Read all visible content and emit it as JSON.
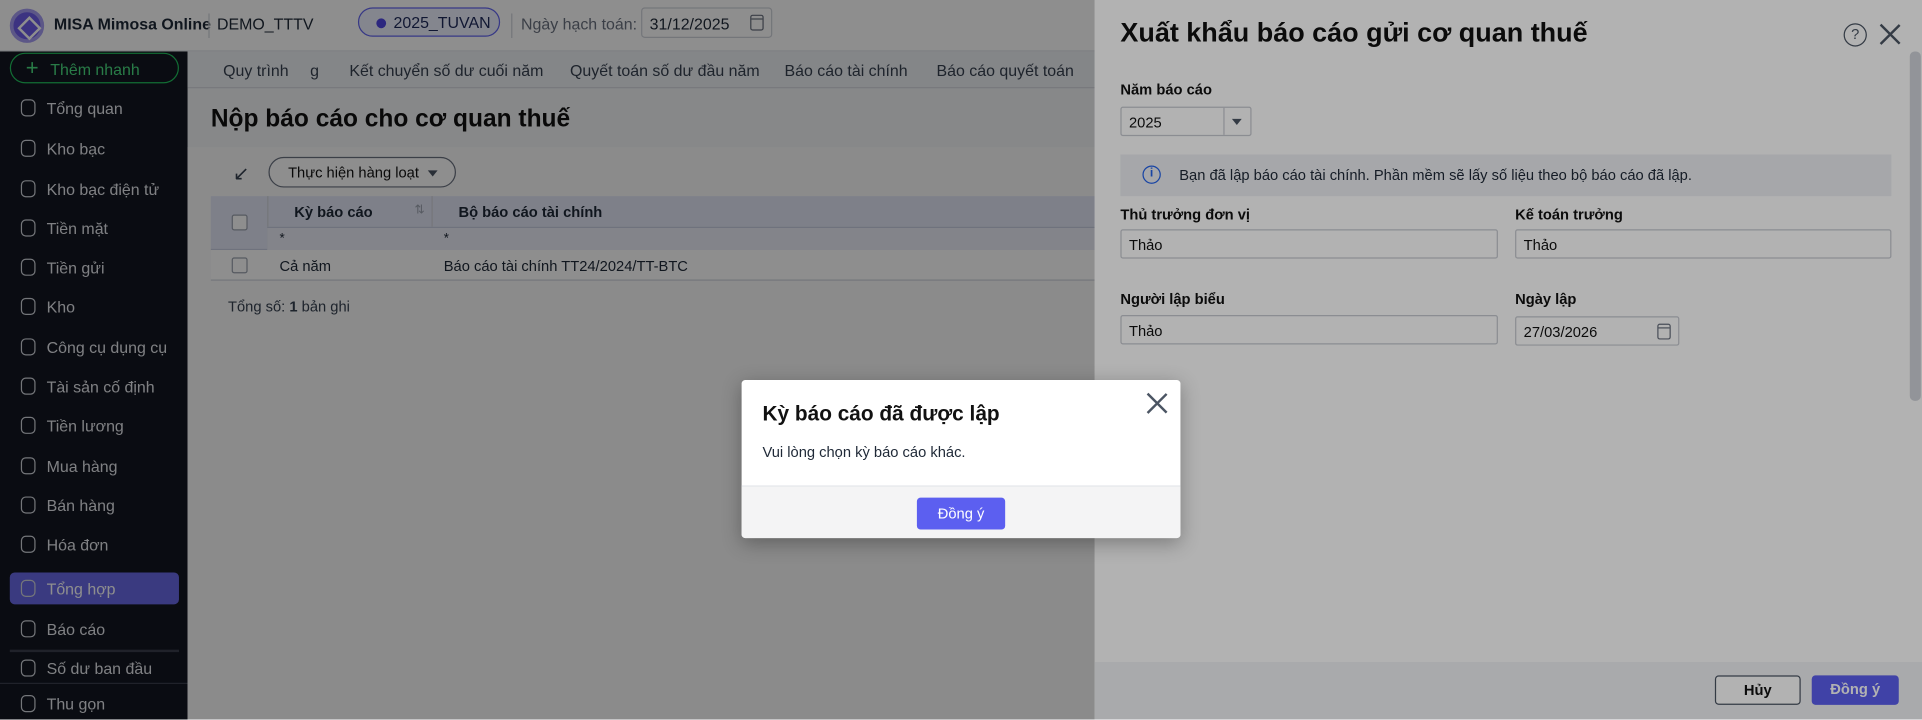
{
  "topbar": {
    "app_name": "MISA Mimosa Online",
    "company": "DEMO_TTTV",
    "database": "2025_TUVAN",
    "posting_date_label": "Ngày hạch toán:",
    "posting_date": "31/12/2025"
  },
  "sidebar": {
    "quick_add": "Thêm nhanh",
    "items": [
      {
        "label": "Tổng quan",
        "icon": "chart-pie-icon"
      },
      {
        "label": "Kho bạc",
        "icon": "treasury-icon"
      },
      {
        "label": "Kho bạc điện tử",
        "icon": "e-treasury-icon"
      },
      {
        "label": "Tiền mặt",
        "icon": "cash-icon"
      },
      {
        "label": "Tiền gửi",
        "icon": "deposit-icon"
      },
      {
        "label": "Kho",
        "icon": "warehouse-icon"
      },
      {
        "label": "Công cụ dụng cụ",
        "icon": "tools-icon"
      },
      {
        "label": "Tài sản cố định",
        "icon": "asset-icon"
      },
      {
        "label": "Tiền lương",
        "icon": "salary-icon"
      },
      {
        "label": "Mua hàng",
        "icon": "cart-icon"
      },
      {
        "label": "Bán hàng",
        "icon": "store-icon"
      },
      {
        "label": "Hóa đơn",
        "icon": "invoice-icon"
      },
      {
        "label": "Tổng hợp",
        "icon": "summary-icon",
        "active": true
      },
      {
        "label": "Báo cáo",
        "icon": "report-icon"
      }
    ],
    "opening_balance": "Số dư ban đầu",
    "collapse": "Thu gọn"
  },
  "main": {
    "tabs": [
      "Quy trình",
      "g",
      "Kết chuyển số dư cuối năm",
      "Quyết toán số dư đầu năm",
      "Báo cáo tài chính",
      "Báo cáo quyết toán"
    ],
    "title": "Nộp báo cáo cho cơ quan thuế",
    "batch_button": "Thực hiện hàng loạt",
    "table": {
      "columns": [
        "Kỳ báo cáo",
        "Bộ báo cáo tài chính"
      ],
      "filter": [
        "*",
        "*"
      ],
      "rows": [
        [
          "Cả năm",
          "Báo cáo tài chính TT24/2024/TT-BTC"
        ]
      ]
    },
    "total_label": "Tổng số:",
    "total_count": "1",
    "total_unit": "bản ghi"
  },
  "panel": {
    "title": "Xuất khẩu báo cáo gửi cơ quan thuế",
    "year_label": "Năm báo cáo",
    "year": "2025",
    "info": "Bạn đã lập báo cáo tài chính. Phần mềm sẽ lấy số liệu theo bộ báo cáo đã lập.",
    "head_label": "Thủ trưởng đơn vị",
    "head": "Thảo",
    "chief_acc_label": "Kế toán trưởng",
    "chief_acc": "Thảo",
    "preparer_label": "Người lập biểu",
    "preparer": "Thảo",
    "date_label": "Ngày lập",
    "date": "27/03/2026",
    "cancel": "Hủy",
    "ok": "Đồng ý",
    "help": "?"
  },
  "dialog": {
    "title": "Kỳ báo cáo đã được lập",
    "message": "Vui lòng chọn kỳ báo cáo khác.",
    "ok": "Đồng ý"
  },
  "colors": {
    "primary": "#5c5ff0",
    "sidebar": "#131722",
    "quick_add": "#22c55e"
  }
}
